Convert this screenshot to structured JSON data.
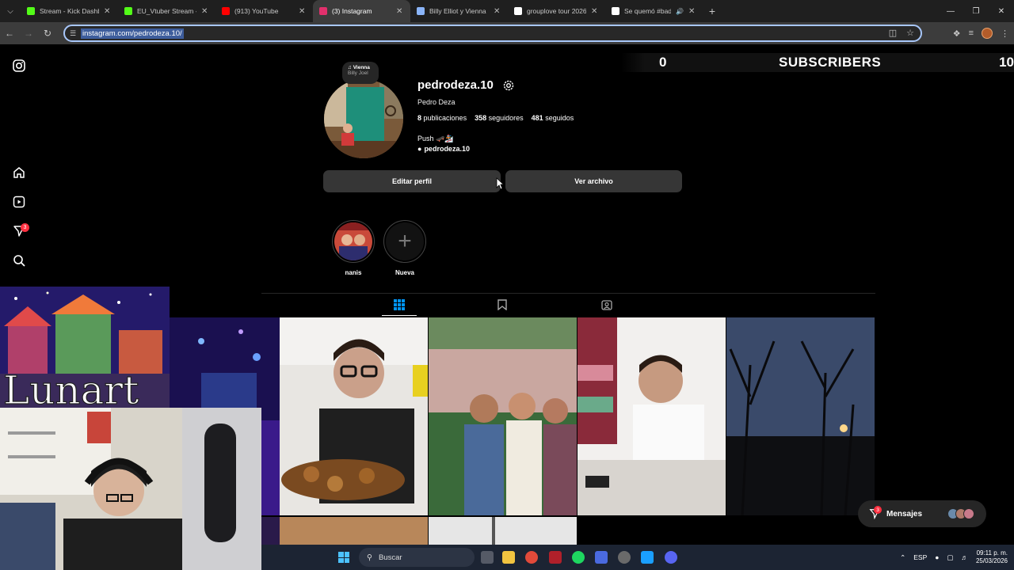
{
  "browser": {
    "tabs": [
      {
        "title": "Stream - Kick Dashboard",
        "favicon": "kick-icon",
        "color": "#53fc18"
      },
      {
        "title": "EU_Vtuber Stream - Kick",
        "favicon": "kick-icon",
        "color": "#53fc18"
      },
      {
        "title": "(913) YouTube",
        "favicon": "youtube-icon",
        "color": "#ff0000"
      },
      {
        "title": "(3) Instagram",
        "favicon": "instagram-icon",
        "color": "#e1306c",
        "active": true
      },
      {
        "title": "Billy Elliot y Vienna",
        "favicon": "gemini-icon",
        "color": "#8ab4f8"
      },
      {
        "title": "grouplove tour 2026",
        "favicon": "google-icon",
        "color": "#ffffff"
      },
      {
        "title": "Se quemó #badb",
        "favicon": "tiktok-icon",
        "color": "#ffffff",
        "audio": true
      }
    ],
    "url": "instagram.com/pedrodeza.10/"
  },
  "sidebar": {
    "notifications_badge": "3"
  },
  "profile": {
    "note_title": "Vienna",
    "note_artist": "Billy Joel",
    "username": "pedrodeza.10",
    "full_name": "Pedro Deza",
    "posts_count": "8",
    "posts_label": "publicaciones",
    "followers_count": "358",
    "followers_label": "seguidores",
    "following_count": "481",
    "following_label": "seguidos",
    "bio": "Push 🛹🏂",
    "threads_handle": "pedrodeza.10",
    "edit_button": "Editar perfil",
    "archive_button": "Ver archivo"
  },
  "highlights": [
    {
      "label": "nanis"
    },
    {
      "label": "Nueva"
    }
  ],
  "stream_overlay": {
    "sub_count": "0",
    "sub_label": "SUBSCRIBERS",
    "sub_goal": "10",
    "art_text": "Lunart"
  },
  "messages": {
    "label": "Mensajes",
    "badge": "3"
  },
  "taskbar": {
    "search_placeholder": "Buscar",
    "language": "ESP",
    "time": "09:11 p. m.",
    "date": "25/03/2026"
  }
}
